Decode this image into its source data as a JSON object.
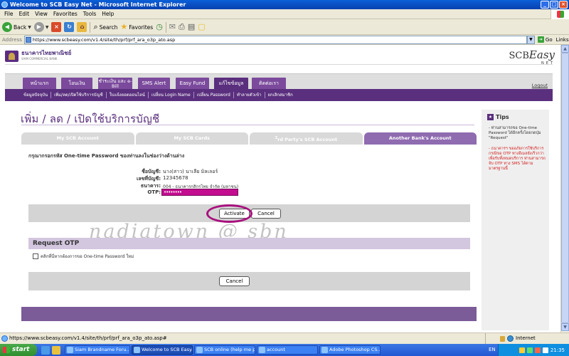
{
  "window": {
    "title": "Welcome to SCB Easy Net - Microsoft Internet Explorer"
  },
  "menu": [
    "File",
    "Edit",
    "View",
    "Favorites",
    "Tools",
    "Help"
  ],
  "toolbar": {
    "back": "Back",
    "search": "Search",
    "favorites": "Favorites"
  },
  "address": {
    "label": "Address",
    "url": "https://www.scbeasy.com/v1.4/site/th/prf/prf_ara_o3p_ato.asp",
    "go": "Go",
    "links": "Links"
  },
  "bank": {
    "name_th": "ธนาคารไทยพาณิชย์",
    "name_en": "SIAM COMMERCIAL BANK",
    "easy_logo_scb": "SCB",
    "easy_logo_easy": "Easy",
    "easy_logo_net": "NET"
  },
  "nav": {
    "tabs": [
      {
        "label": "หน้าแรก"
      },
      {
        "label": "โอนเงิน"
      },
      {
        "label": "ชำระเงิน และ e-Bill"
      },
      {
        "label": "SMS Alert"
      },
      {
        "label": "Easy Fund"
      },
      {
        "label": "แก้ไขข้อมูล"
      },
      {
        "label": "ติดต่อเรา"
      }
    ],
    "logout": "Logout",
    "subnav": [
      "ข้อมูลปัจจุบัน",
      "เพิ่ม/ลด/เปิดใช้บริการบัญชี",
      "ใบแจ้งยอดออนไลน์",
      "เปลี่ยน Login Name",
      "เปลี่ยน Password",
      "ทำลายตัวเข้า",
      "ยกเลิกสมาชิก"
    ]
  },
  "page": {
    "title": "เพิ่ม / ลด / เปิดใช้บริการบัญชี",
    "content_tabs": [
      {
        "label": "My SCB Account"
      },
      {
        "label": "My SCB Cards"
      },
      {
        "label_sup": "3",
        "label_rest": "rd Party's SCB Account"
      },
      {
        "label": "Another Bank's Account"
      }
    ],
    "instruction": "กรุณากรอกรหัส One-time Password ของท่านลงในช่องว่างด้านล่าง",
    "fields": {
      "account_name_label": "ชื่อบัญชี:",
      "account_name_value": "นาง(สาว) นาเลีย มิลเลอร์",
      "account_no_label": "เลขที่บัญชี:",
      "account_no_value": "12345678",
      "bank_label": "ธนาคาร:",
      "bank_value": "004 - ธนาคารกสิกรไทย จำกัด (มหาชน)",
      "otp_label": "OTP:",
      "otp_value": "••••••••"
    },
    "activate_button": "Activate",
    "cancel_button": "Cancel",
    "request_otp_heading": "Request OTP",
    "request_otp_checkbox_label": "คลิกที่นี่หากต้องการขอ One-time Password ใหม่",
    "cancel_button_2": "Cancel",
    "watermark": "nadiatown @ sbn"
  },
  "tips": {
    "title": "Tips",
    "tip1": "- ท่านสามารถขอ One-time Password ได้อีกครั้งโดยกดปุ่ม \"Request\"",
    "tip2": "- ธนาคารฯ ขออภัยการใช้บริการ กรณีขอ OTP ทางอีเมลยังเร็วกว่าเพื่อรับทั้งหมดบริการ ท่านสามารถจับ OTP ทาง SMS ได้ตามมาตรฐานนี้"
  },
  "status": {
    "url": "https://www.scbeasy.com/v1.4/site/th/prf/prf_ara_o3p_ato.asp#",
    "zone": "Internet"
  },
  "taskbar": {
    "start": "start",
    "items": [
      {
        "label": "Siam Brandname Foru..."
      },
      {
        "label": "Welcome to SCB Easy..."
      },
      {
        "label": "SCB online (help me p..."
      },
      {
        "label": "account"
      },
      {
        "label": "Adobe Photoshop CS..."
      }
    ],
    "lang": "EN",
    "time": "21:35"
  }
}
